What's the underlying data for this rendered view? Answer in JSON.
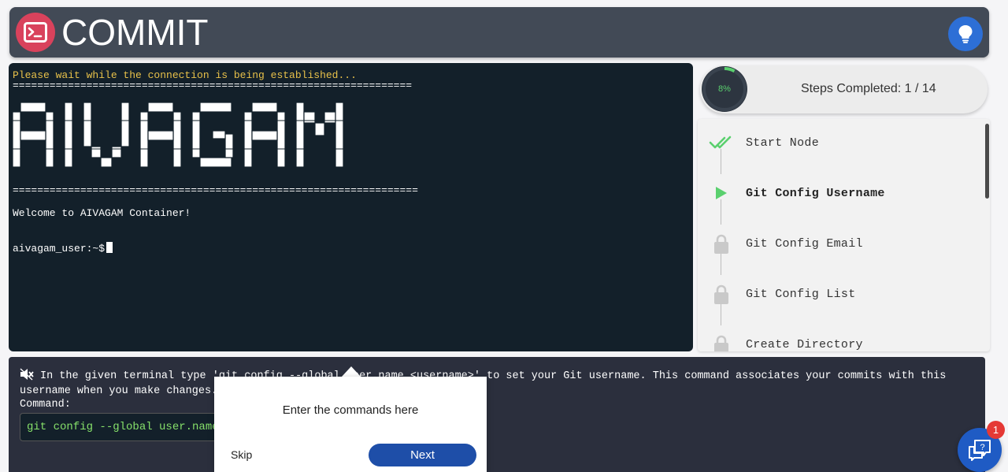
{
  "header": {
    "title": "COMMIT",
    "logo_icon": "terminal-icon",
    "hint_icon": "lightbulb-icon"
  },
  "terminal": {
    "connecting": "Please wait while the connection is being established...",
    "rule_top": "=================================================================",
    "banner": "AIVAGAM",
    "rule_bottom": "==================================================================",
    "welcome": "Welcome to AIVAGAM Container!",
    "prompt": "aivagam_user:~$"
  },
  "progress": {
    "percent": 8,
    "percent_label": "8%",
    "label": "Steps Completed: 1 / 14",
    "color": "#5ad06e"
  },
  "steps": [
    {
      "label": "Start Node",
      "state": "done",
      "icon": "double-check-icon"
    },
    {
      "label": "Git Config Username",
      "state": "active",
      "icon": "play-icon"
    },
    {
      "label": "Git Config Email",
      "state": "locked",
      "icon": "lock-icon"
    },
    {
      "label": "Git Config List",
      "state": "locked",
      "icon": "lock-icon"
    },
    {
      "label": "Create Directory",
      "state": "locked",
      "icon": "lock-icon"
    }
  ],
  "instructions": {
    "text": "In the given terminal type 'git config --global user.name <username>' to set your Git username. This command associates your commits with this username when you make changes.",
    "command_label": "Command:",
    "command": "git config --global user.name '"
  },
  "tour": {
    "message": "Enter the commands here",
    "skip_label": "Skip",
    "next_label": "Next"
  },
  "help": {
    "badge_count": "1",
    "icon": "chat-question-icon"
  }
}
